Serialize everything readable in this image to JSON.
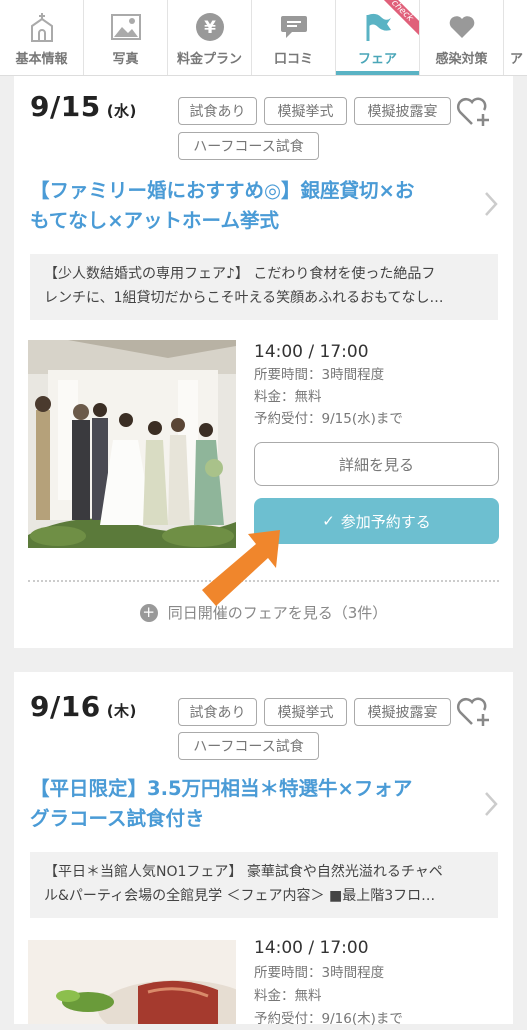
{
  "tabs": [
    {
      "label": "基本情報",
      "icon": "chapel-icon"
    },
    {
      "label": "写真",
      "icon": "photo-icon"
    },
    {
      "label": "料金プラン",
      "icon": "yen-icon"
    },
    {
      "label": "口コミ",
      "icon": "speech-bubble-icon"
    },
    {
      "label": "フェア",
      "icon": "flag-icon",
      "active": true,
      "badge": "check"
    },
    {
      "label": "感染対策",
      "icon": "heart-icon"
    },
    {
      "label": "ア",
      "icon": ""
    }
  ],
  "fairs": [
    {
      "date": "9/15",
      "weekday": "(水)",
      "tags": [
        "試食あり",
        "模擬挙式",
        "模擬披露宴",
        "ハーフコース試食"
      ],
      "title_line1": "【ファミリー婚におすすめ◎】銀座貸切×お",
      "title_line2": "もてなし×アットホーム挙式",
      "desc_line1": "【少人数結婚式の専用フェア♪】 こだわり食材を使った絶品フ",
      "desc_line2": "レンチに、1組貸切だからこそ叶える笑顔あふれるおもてなし…",
      "time": "14:00 / 17:00",
      "duration": "所要時間：3時間程度",
      "price": "料金：無料",
      "deadline": "予約受付：9/15(水)まで",
      "detail_button": "詳細を見る",
      "reserve_button": "参加予約する",
      "same_day": "同日開催のフェアを見る（3件）"
    },
    {
      "date": "9/16",
      "weekday": "(木)",
      "tags": [
        "試食あり",
        "模擬挙式",
        "模擬披露宴",
        "ハーフコース試食"
      ],
      "title_line1": "【平日限定】3.5万円相当＊特選牛×フォア",
      "title_line2": "グラコース試食付き",
      "desc_line1": "【平日＊当館人気NO1フェア】 豪華試食や自然光溢れるチャペ",
      "desc_line2": "ル&パーティ会場の全館見学 ＜フェア内容＞ ■最上階3フロ…",
      "time": "14:00 / 17:00",
      "duration": "所要時間：3時間程度",
      "price": "料金：無料",
      "deadline": "予約受付：9/16(木)まで"
    }
  ],
  "colors": {
    "accent": "#4a9bd6",
    "button": "#6dbfd0",
    "arrow": "#f0862c",
    "tab_active": "#5ab3c4"
  }
}
